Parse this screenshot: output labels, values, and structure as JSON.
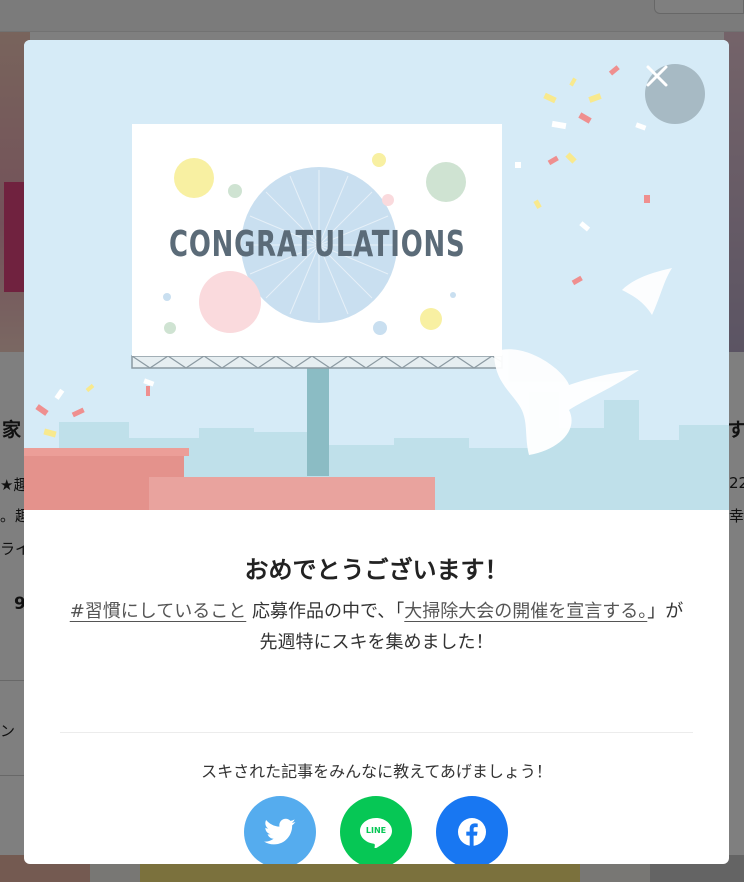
{
  "background": {
    "fragments": [
      "家",
      "す",
      "★趣",
      "22",
      "。趣",
      "幸福",
      "ライ",
      "9",
      "ン"
    ]
  },
  "modal": {
    "hero": {
      "billboard_text": "CONGRATULATIONS"
    },
    "title": "おめでとうございます！",
    "description": {
      "hashtag_link": "#習慣にしていること",
      "middle_text": " 応募作品の中で、「",
      "article_link": "大掃除大会の開催を宣言する。",
      "end_text": "」が先週特にスキを集めました！"
    },
    "share_prompt": "スキされた記事をみんなに教えてあげましょう！",
    "share_buttons": [
      {
        "name": "twitter",
        "icon": "twitter-icon",
        "color": "#55acee"
      },
      {
        "name": "line",
        "icon": "line-icon",
        "label": "LINE",
        "color": "#06c755"
      },
      {
        "name": "facebook",
        "icon": "facebook-icon",
        "color": "#1877f2"
      }
    ],
    "close_icon": "close-icon"
  }
}
